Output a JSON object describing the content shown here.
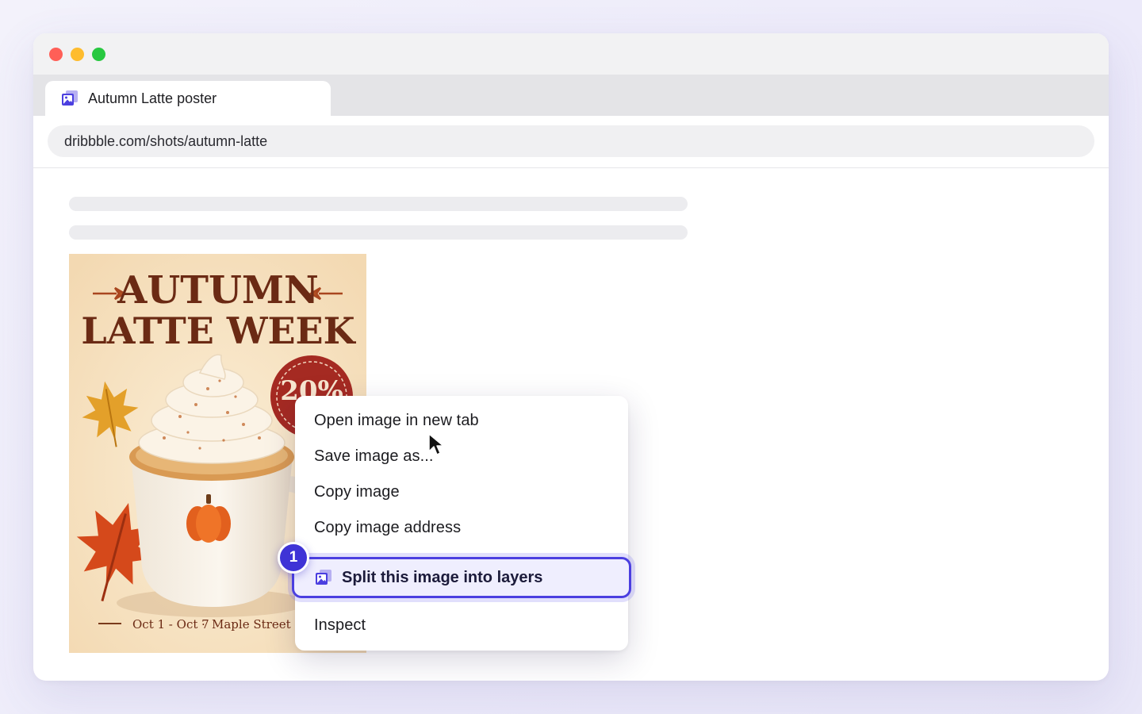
{
  "browser": {
    "tab": {
      "title": "Autumn Latte poster",
      "icon": "image-layers-icon"
    },
    "address": "dribbble.com/shots/autumn-latte"
  },
  "poster": {
    "headline_line1": "AUTUMN",
    "headline_line2": "LATTE WEEK",
    "discount": "20%",
    "footer_dates": "Oct 1 - Oct 7",
    "footer_separator": "·",
    "footer_venue": "Maple Street Caf"
  },
  "context_menu": {
    "items": [
      {
        "label": "Open image in new tab"
      },
      {
        "label": "Save image as..."
      },
      {
        "label": "Copy image"
      },
      {
        "label": "Copy image address"
      }
    ],
    "highlighted": {
      "label": "Split this image into layers",
      "icon": "image-layers-icon",
      "step": "1"
    },
    "last_item": {
      "label": "Inspect"
    }
  },
  "colors": {
    "accent": "#4b3fe0",
    "poster_bg": "#f8e6c8",
    "poster_title": "#6b2a14",
    "badge_red": "#a52a22"
  }
}
